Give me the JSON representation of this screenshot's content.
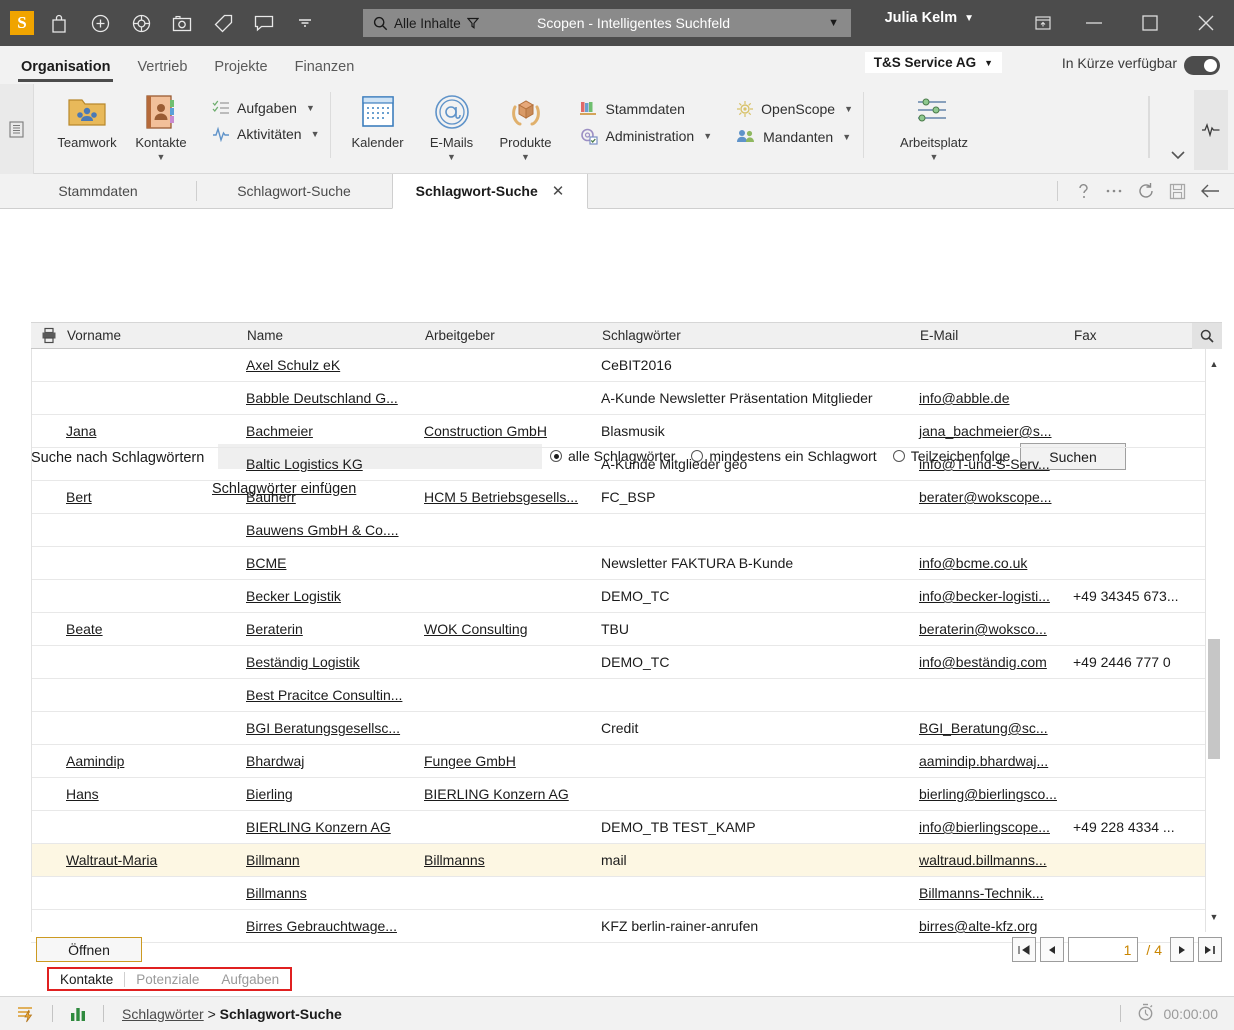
{
  "titlebar": {
    "logo": "S",
    "icons": [
      "bag-icon",
      "plus-circle-icon",
      "lifebuoy-icon",
      "camera-icon",
      "tag-icon",
      "chat-icon",
      "chevron-down-icon"
    ],
    "search_scope": "Alle Inhalte",
    "search_title": "Scopen - Intelligentes Suchfeld",
    "user": "Julia Kelm",
    "window_icons": [
      "restore-panel-icon",
      "minimize-icon",
      "maximize-icon",
      "close-icon"
    ]
  },
  "menubar": {
    "items": [
      {
        "label": "Organisation",
        "active": true
      },
      {
        "label": "Vertrieb",
        "active": false
      },
      {
        "label": "Projekte",
        "active": false
      },
      {
        "label": "Finanzen",
        "active": false
      }
    ],
    "tenant": "T&S Service AG",
    "availability_label": "In Kürze verfügbar",
    "availability_on": true
  },
  "ribbon": {
    "big_buttons": [
      {
        "label": "Teamwork",
        "icon": "teamwork-folder-icon",
        "dropdown": false
      },
      {
        "label": "Kontakte",
        "icon": "contacts-book-icon",
        "dropdown": true
      },
      {
        "label": "Kalender",
        "icon": "calendar-icon",
        "dropdown": false
      },
      {
        "label": "E-Mails",
        "icon": "at-sign-icon",
        "dropdown": true
      },
      {
        "label": "Produkte",
        "icon": "product-box-icon",
        "dropdown": true
      },
      {
        "label": "Arbeitsplatz",
        "icon": "sliders-icon",
        "dropdown": true
      }
    ],
    "small_buttons": [
      {
        "label": "Aufgaben",
        "icon": "task-list-icon",
        "caret": true
      },
      {
        "label": "Aktivitäten",
        "icon": "activity-pulse-icon",
        "caret": true
      },
      {
        "label": "Stammdaten",
        "icon": "books-icon",
        "caret": false
      },
      {
        "label": "Administration",
        "icon": "gear-checkbox-icon",
        "caret": true
      },
      {
        "label": "OpenScope",
        "icon": "openscope-icon",
        "caret": true
      },
      {
        "label": "Mandanten",
        "icon": "clients-group-icon",
        "caret": true
      }
    ]
  },
  "tabs": [
    {
      "label": "Stammdaten",
      "active": false,
      "closable": false
    },
    {
      "label": "Schlagwort-Suche",
      "active": false,
      "closable": false
    },
    {
      "label": "Schlagwort-Suche",
      "active": true,
      "closable": true
    }
  ],
  "tab_tools": [
    "help-icon",
    "more-icon",
    "refresh-icon",
    "save-icon",
    "back-arrow-icon"
  ],
  "search_panel": {
    "label": "Suche nach Schlagwörtern",
    "input_value": "",
    "input_placeholder": "",
    "radios": [
      {
        "label": "alle Schlagwörter",
        "selected": true
      },
      {
        "label": "mindestens ein Schlagwort",
        "selected": false
      },
      {
        "label": "Teilzeichenfolge",
        "selected": false
      }
    ],
    "search_button": "Suchen",
    "insert_link": "Schlagwörter einfügen"
  },
  "table": {
    "columns": [
      "Vorname",
      "Name",
      "Arbeitgeber",
      "Schlagwörter",
      "E-Mail",
      "Fax"
    ],
    "print_icon": "printer-icon",
    "search_icon": "search-icon",
    "rows": [
      {
        "vorname": "",
        "name": "Axel Schulz eK",
        "arbeitgeber": "",
        "schlagwoerter": "CeBIT2016",
        "email": "",
        "fax": "",
        "selected": false
      },
      {
        "vorname": "",
        "name": "Babble Deutschland G...",
        "arbeitgeber": "",
        "schlagwoerter": "A-Kunde Newsletter Präsentation Mitglieder",
        "email": "info@abble.de",
        "fax": "",
        "selected": false
      },
      {
        "vorname": "Jana",
        "name": "Bachmeier",
        "arbeitgeber": "Construction GmbH",
        "schlagwoerter": "Blasmusik",
        "email": "jana_bachmeier@s...",
        "fax": "",
        "selected": false
      },
      {
        "vorname": "",
        "name": "Baltic Logistics KG",
        "arbeitgeber": "",
        "schlagwoerter": "A-Kunde Mitglieder geo",
        "email": "info@T-und-S-Serv...",
        "fax": "",
        "selected": false
      },
      {
        "vorname": "Bert",
        "name": "Bauherr",
        "arbeitgeber": "HCM 5 Betriebsgesells...",
        "schlagwoerter": "FC_BSP",
        "email": "berater@wokscope...",
        "fax": "",
        "selected": false
      },
      {
        "vorname": "",
        "name": "Bauwens GmbH & Co....",
        "arbeitgeber": "",
        "schlagwoerter": "",
        "email": "",
        "fax": "",
        "selected": false
      },
      {
        "vorname": "",
        "name": "BCME",
        "arbeitgeber": "",
        "schlagwoerter": "Newsletter FAKTURA B-Kunde",
        "email": "info@bcme.co.uk",
        "fax": "",
        "selected": false
      },
      {
        "vorname": "",
        "name": "Becker Logistik",
        "arbeitgeber": "",
        "schlagwoerter": "DEMO_TC",
        "email": "info@becker-logisti...",
        "fax": "+49 34345 673...",
        "selected": false
      },
      {
        "vorname": "Beate",
        "name": "Beraterin",
        "arbeitgeber": "WOK Consulting",
        "schlagwoerter": "TBU",
        "email": "beraterin@woksco...",
        "fax": "",
        "selected": false
      },
      {
        "vorname": "",
        "name": "Beständig Logistik",
        "arbeitgeber": "",
        "schlagwoerter": "DEMO_TC",
        "email": "info@beständig.com",
        "fax": "+49 2446 777 0",
        "selected": false
      },
      {
        "vorname": "",
        "name": "Best Pracitce Consultin...",
        "arbeitgeber": "",
        "schlagwoerter": "",
        "email": "",
        "fax": "",
        "selected": false
      },
      {
        "vorname": "",
        "name": "BGI Beratungsgesellsc...",
        "arbeitgeber": "",
        "schlagwoerter": "Credit",
        "email": "BGI_Beratung@sc...",
        "fax": "",
        "selected": false
      },
      {
        "vorname": "Aamindip",
        "name": "Bhardwaj",
        "arbeitgeber": "Fungee GmbH",
        "schlagwoerter": "",
        "email": "aamindip.bhardwaj...",
        "fax": "",
        "selected": false
      },
      {
        "vorname": "Hans",
        "name": "Bierling",
        "arbeitgeber": "BIERLING Konzern AG",
        "schlagwoerter": "",
        "email": "bierling@bierlingsco...",
        "fax": "",
        "selected": false
      },
      {
        "vorname": "",
        "name": "BIERLING Konzern AG",
        "arbeitgeber": "",
        "schlagwoerter": "DEMO_TB TEST_KAMP",
        "email": "info@bierlingscope...",
        "fax": "+49 228 4334 ...",
        "selected": false
      },
      {
        "vorname": "Waltraut-Maria",
        "name": "Billmann",
        "arbeitgeber": "Billmanns",
        "schlagwoerter": "mail",
        "email": "waltraud.billmanns...",
        "fax": "",
        "selected": true
      },
      {
        "vorname": "",
        "name": "Billmanns",
        "arbeitgeber": "",
        "schlagwoerter": "",
        "email": "Billmanns-Technik...",
        "fax": "",
        "selected": false
      },
      {
        "vorname": "",
        "name": "Birres Gebrauchtwage...",
        "arbeitgeber": "",
        "schlagwoerter": "KFZ berlin-rainer-anrufen",
        "email": "birres@alte-kfz.org",
        "fax": "",
        "selected": false
      }
    ]
  },
  "footer": {
    "open_button": "Öffnen",
    "pager": {
      "first": "first-page-icon",
      "prev": "prev-page-icon",
      "current": "1",
      "separator": "/",
      "total": "4",
      "next": "next-page-icon",
      "last": "last-page-icon"
    },
    "subtabs": [
      {
        "label": "Kontakte",
        "active": true
      },
      {
        "label": "Potenziale",
        "active": false
      },
      {
        "label": "Aufgaben",
        "active": false
      }
    ],
    "highlight_color": "#e02020"
  },
  "statusbar": {
    "icons": [
      "lightning-list-icon",
      "bar-chart-icon"
    ],
    "breadcrumb_root": "Schlagwörter",
    "breadcrumb_sep": ">",
    "breadcrumb_current": "Schlagwort-Suche",
    "timer_icon": "stopwatch-icon",
    "timer": "00:00:00"
  },
  "colors": {
    "brand_orange": "#f0a400",
    "titlebar_bg": "#4c4c4c",
    "selected_row": "#fdf7e3",
    "highlight_red": "#e02020",
    "pager_amber": "#c98500"
  }
}
